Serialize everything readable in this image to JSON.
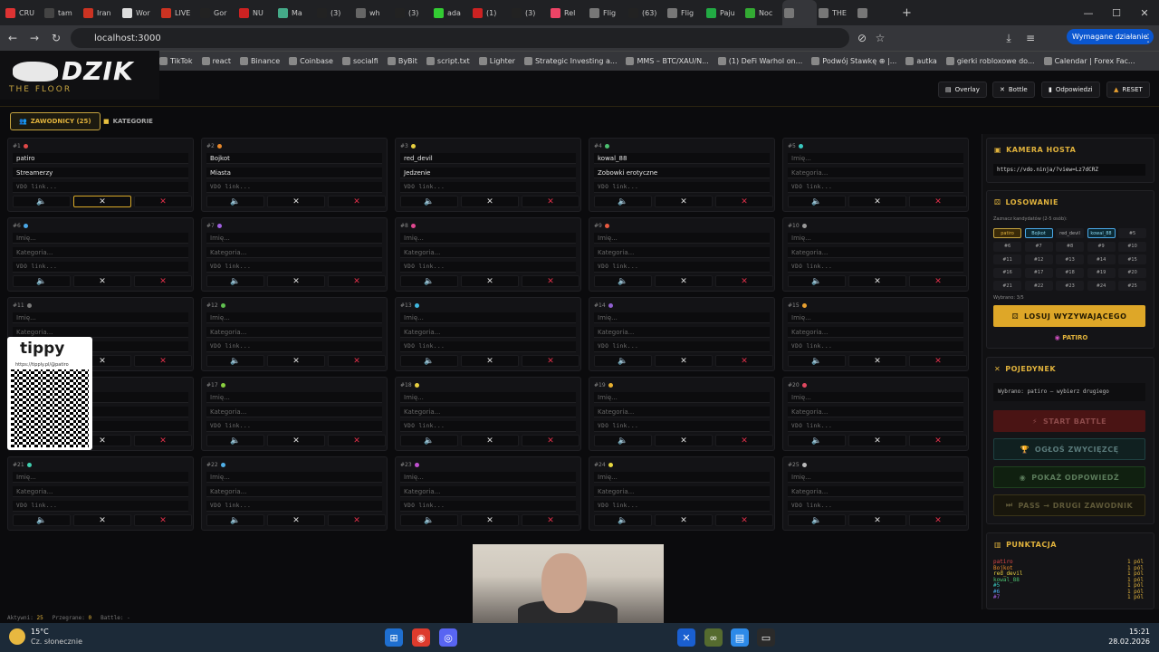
{
  "browser": {
    "tabs": [
      "CRU",
      "tam",
      "Iran",
      "Wor",
      "LIVE",
      "Gor",
      "NU",
      "Ma",
      "(3)",
      "wh",
      "(3)",
      "ada",
      "(1)",
      "(3)",
      "Rel",
      "Flig",
      "(63)",
      "Flig",
      "Paju",
      "Noc",
      "",
      "THE",
      ""
    ],
    "url": "localhost:3000",
    "required_action": "Wymagane działanie",
    "bookmarks": [
      "TikTok",
      "react",
      "Binance",
      "Coinbase",
      "socialfi",
      "ByBit",
      "script.txt",
      "Lighter",
      "Strategic Investing a...",
      "MMS – BTC/XAU/N...",
      "(1) DeFi Warhol on...",
      "Podwój Stawkę ⊕ |...",
      "autka",
      "gierki robloxowe do...",
      "Calendar | Forex Fac..."
    ]
  },
  "app": {
    "logo": "DZIK",
    "logo_sub": "THE FLOOR",
    "header_buttons": [
      "Overlay",
      "Bottle",
      "Odpowiedzi",
      "RESET"
    ],
    "tabs": [
      "ZAWODNICY (25)",
      "KATEGORIE"
    ],
    "contestants": [
      {
        "num": "#1",
        "color": "#e04848",
        "name": "patiro",
        "category": "Streamerzy"
      },
      {
        "num": "#2",
        "color": "#e8882a",
        "name": "Bojkot",
        "category": "Miasta"
      },
      {
        "num": "#3",
        "color": "#e8d040",
        "name": "red_devil",
        "category": "Jedzenie"
      },
      {
        "num": "#4",
        "color": "#4cc070",
        "name": "kowal_88",
        "category": "Zobowki erotyczne"
      },
      {
        "num": "#5",
        "color": "#3ac8c0",
        "name": "",
        "category": ""
      },
      {
        "num": "#6",
        "color": "#4aa8e8",
        "name": "",
        "category": ""
      },
      {
        "num": "#7",
        "color": "#a060e0",
        "name": "",
        "category": ""
      },
      {
        "num": "#8",
        "color": "#e04890",
        "name": "",
        "category": ""
      },
      {
        "num": "#9",
        "color": "#e85a40",
        "name": "",
        "category": ""
      },
      {
        "num": "#10",
        "color": "#9a9a9a",
        "name": "",
        "category": ""
      },
      {
        "num": "#11",
        "color": "#7a7a7a",
        "name": "",
        "category": ""
      },
      {
        "num": "#12",
        "color": "#60c050",
        "name": "",
        "category": ""
      },
      {
        "num": "#13",
        "color": "#40b8e0",
        "name": "",
        "category": ""
      },
      {
        "num": "#14",
        "color": "#9060d0",
        "name": "",
        "category": ""
      },
      {
        "num": "#15",
        "color": "#e8a030",
        "name": "",
        "category": ""
      },
      {
        "num": "#16",
        "color": "#e04848",
        "name": "",
        "category": ""
      },
      {
        "num": "#17",
        "color": "#8ad040",
        "name": "",
        "category": ""
      },
      {
        "num": "#18",
        "color": "#e8d040",
        "name": "",
        "category": ""
      },
      {
        "num": "#19",
        "color": "#e8b030",
        "name": "",
        "category": ""
      },
      {
        "num": "#20",
        "color": "#e04860",
        "name": "",
        "category": ""
      },
      {
        "num": "#21",
        "color": "#40d0b0",
        "name": "",
        "category": ""
      },
      {
        "num": "#22",
        "color": "#50b0e8",
        "name": "",
        "category": ""
      },
      {
        "num": "#23",
        "color": "#c050d0",
        "name": "",
        "category": ""
      },
      {
        "num": "#24",
        "color": "#e8d840",
        "name": "",
        "category": ""
      },
      {
        "num": "#25",
        "color": "#bbbbbb",
        "name": "",
        "category": ""
      }
    ],
    "placeholders": {
      "name": "Imię...",
      "category": "Kategoria...",
      "vdo": "VDO link..."
    },
    "card_buttons": [
      "🔈",
      "✕",
      "✕"
    ],
    "host_camera": {
      "title": "KAMERA HOSTA",
      "url": "https://vdo.ninja/?view=Lz7dCRZ"
    },
    "draw": {
      "title": "LOSOWANIE",
      "hint": "Zaznacz kandydatów (2-5 osób):",
      "chips": [
        "patiro",
        "Bojkot",
        "red_devil",
        "kowal_88",
        "#5",
        "#6",
        "#7",
        "#8",
        "#9",
        "#10",
        "#11",
        "#12",
        "#13",
        "#14",
        "#15",
        "#16",
        "#17",
        "#18",
        "#19",
        "#20",
        "#21",
        "#22",
        "#23",
        "#24",
        "#25"
      ],
      "selected": "Wybrano: 3/5",
      "button": "LOSUJ WYZYWAJĄCEGO",
      "winner": "PATIRO"
    },
    "duel": {
      "title": "POJEDYNEK",
      "info": "Wybrano: patiro — wybierz drugiego",
      "buttons": [
        "START BATTLE",
        "OGŁOŚ ZWYCIĘZCĘ",
        "POKAŻ ODPOWIEDŹ",
        "PASS → DRUGI ZAWODNIK"
      ]
    },
    "scoring": {
      "title": "PUNKTACJA",
      "rows": [
        {
          "name": "patiro",
          "pts": "1 pól",
          "color": "#e04848"
        },
        {
          "name": "Bojkot",
          "pts": "1 pól",
          "color": "#e8882a"
        },
        {
          "name": "red_devil",
          "pts": "1 pól",
          "color": "#e8d040"
        },
        {
          "name": "kowal_88",
          "pts": "1 pól",
          "color": "#4cc070"
        },
        {
          "name": "#5",
          "pts": "1 pól",
          "color": "#3ac8c0"
        },
        {
          "name": "#6",
          "pts": "1 pól",
          "color": "#4aa8e8"
        },
        {
          "name": "#7",
          "pts": "1 pól",
          "color": "#a060e0"
        }
      ]
    },
    "status": {
      "active_label": "Aktywni:",
      "active": "25",
      "lost_label": "Przegrane:",
      "lost": "0",
      "battle_label": "Battle:",
      "battle": "-"
    }
  },
  "overlay": {
    "tippy_brand": "tippy",
    "tippy_url": "https://tipply.pl/@patiro"
  },
  "taskbar": {
    "temp": "15°C",
    "weather": "Cz. słonecznie",
    "time": "15:21",
    "date": "28.02.2026"
  }
}
